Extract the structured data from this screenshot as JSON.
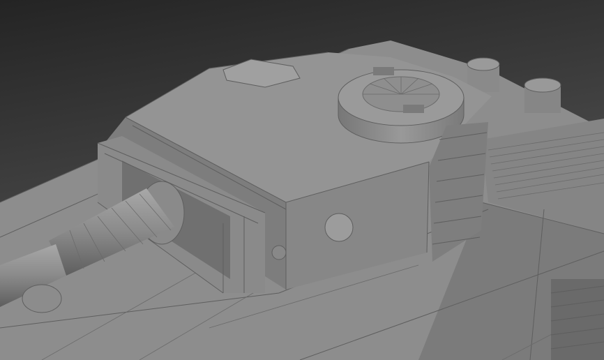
{
  "viewport": {
    "colors": {
      "background_top": "#262626",
      "background_bottom": "#5a5a5a",
      "model_light": "#9a9a9a",
      "model_mid": "#8a8a8a",
      "model_dark": "#777777",
      "edges": "#5e5e5e"
    }
  }
}
